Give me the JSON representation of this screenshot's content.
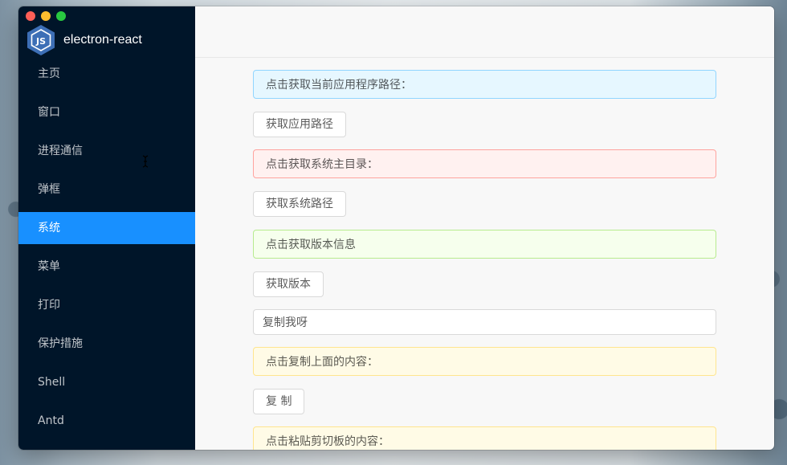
{
  "app": {
    "title": "electron-react",
    "logo_icon": "nodejs-hex-icon"
  },
  "colors": {
    "sidebar_bg": "#001529",
    "accent": "#1890ff"
  },
  "sidebar": {
    "items": [
      {
        "label": "主页",
        "active": false
      },
      {
        "label": "窗口",
        "active": false
      },
      {
        "label": "进程通信",
        "active": false
      },
      {
        "label": "弹框",
        "active": false
      },
      {
        "label": "系统",
        "active": true
      },
      {
        "label": "菜单",
        "active": false
      },
      {
        "label": "打印",
        "active": false
      },
      {
        "label": "保护措施",
        "active": false
      },
      {
        "label": "Shell",
        "active": false
      },
      {
        "label": "Antd",
        "active": false
      }
    ]
  },
  "main": {
    "app_path_alert": "点击获取当前应用程序路径：",
    "app_path_button": "获取应用路径",
    "system_dir_alert": "点击获取系统主目录：",
    "system_path_button": "获取系统路径",
    "version_alert": "点击获取版本信息",
    "version_button": "获取版本",
    "copy_input_value": "复制我呀",
    "copy_alert": "点击复制上面的内容：",
    "copy_button": "复 制",
    "paste_alert": "点击粘贴剪切板的内容："
  }
}
